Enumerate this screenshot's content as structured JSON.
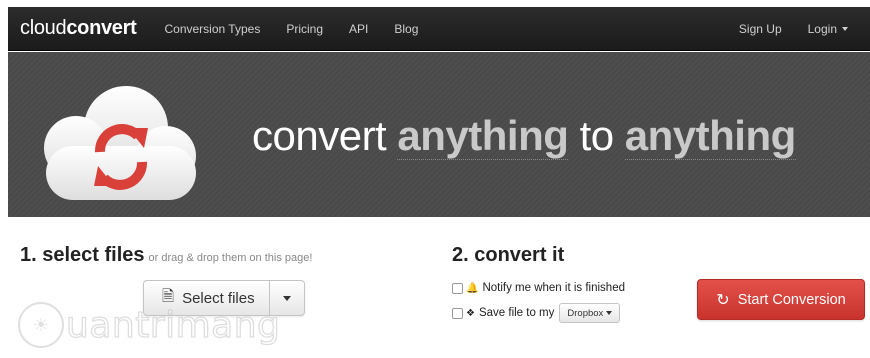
{
  "navbar": {
    "brand_light": "cloud",
    "brand_bold": "convert",
    "links": [
      "Conversion Types",
      "Pricing",
      "API",
      "Blog"
    ],
    "signup": "Sign Up",
    "login": "Login"
  },
  "hero": {
    "tagline_part1": "convert ",
    "tagline_hl1": "anything",
    "tagline_part2": " to ",
    "tagline_hl2": "anything",
    "colors": {
      "background": "#4a4a4a",
      "cloud": "#f2f2f2",
      "arrows": "#d9403a"
    }
  },
  "step1": {
    "title": "1. select files",
    "hint": "or drag & drop them on this page!",
    "select_button": "Select files",
    "select_icon": "add-file-icon"
  },
  "step2": {
    "title": "2. convert it",
    "notify_label": "Notify me when it is finished",
    "notify_icon": "bell-icon",
    "save_label": "Save file to my",
    "save_icon": "dropbox-icon",
    "dropbox_option": "Dropbox",
    "start_button": "Start Conversion",
    "start_icon": "refresh-icon",
    "start_color": "#d9403a"
  },
  "watermark": {
    "text": "uantrimang"
  }
}
